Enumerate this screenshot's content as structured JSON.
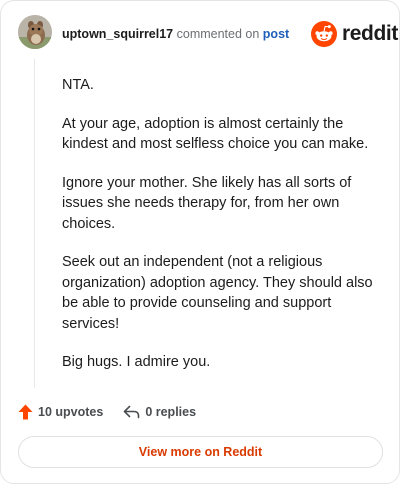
{
  "comment": {
    "username": "uptown_squirrel17",
    "action_text": "commented on",
    "post_link": "post",
    "paragraphs": [
      "NTA.",
      "At your age, adoption is almost certainly the kindest and most selfless choice you can make.",
      "Ignore your mother. She likely has all sorts of issues she needs therapy for, from her own choices.",
      "Seek out an independent (not a religious organization) adoption agency. They should also be able to provide counseling and support services!",
      "Big hugs. I admire you."
    ]
  },
  "brand": {
    "wordmark": "reddit",
    "color": "#ff4500"
  },
  "actions": {
    "upvotes": "10 upvotes",
    "replies": "0 replies"
  },
  "footer": {
    "view_more": "View more on Reddit"
  },
  "icons": {
    "avatar": "squirrel-avatar",
    "logo": "reddit-snoo-icon",
    "upvote": "upvote-arrow-icon",
    "reply": "reply-arrow-icon"
  }
}
